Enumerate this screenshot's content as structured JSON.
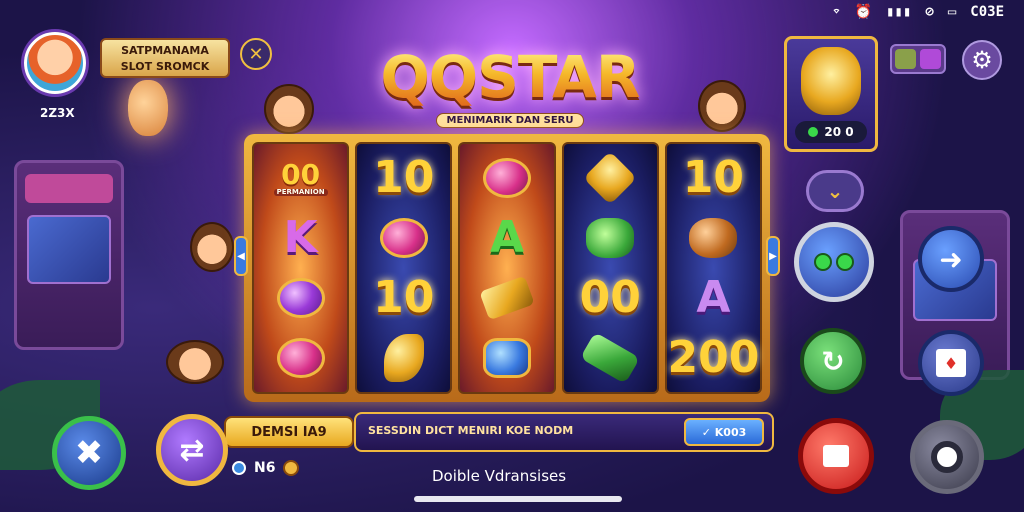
{
  "status_bar": {
    "icons": [
      "wifi-icon",
      "alarm-icon",
      "signal-icon",
      "mute-icon",
      "screen-icon"
    ],
    "battery_text": "C03E"
  },
  "player": {
    "name": "SATPMANAMA SLOT SROMCK",
    "id": "2Z3X"
  },
  "logo": {
    "title": "QQSTAR",
    "subtitle": "MENIMARIK DAN SERU"
  },
  "reels": [
    {
      "tone": "warm",
      "symbols": [
        {
          "kind": "bonus",
          "text": "00",
          "caption": "PERMANION"
        },
        {
          "kind": "letter-k",
          "text": "K"
        },
        {
          "kind": "gem",
          "style": "purple"
        },
        {
          "kind": "gem",
          "style": "pink"
        }
      ]
    },
    {
      "tone": "cool",
      "symbols": [
        {
          "kind": "num",
          "text": "10"
        },
        {
          "kind": "gem",
          "style": "pink"
        },
        {
          "kind": "num",
          "text": "10"
        },
        {
          "kind": "gem",
          "style": "gold-crescent"
        }
      ]
    },
    {
      "tone": "warm",
      "symbols": [
        {
          "kind": "gem",
          "style": "pink"
        },
        {
          "kind": "letter-a",
          "text": "A"
        },
        {
          "kind": "gem",
          "style": "gold-bar"
        },
        {
          "kind": "gem",
          "style": "blue"
        }
      ]
    },
    {
      "tone": "cool",
      "symbols": [
        {
          "kind": "gem",
          "style": "gold"
        },
        {
          "kind": "gem",
          "style": "green"
        },
        {
          "kind": "num",
          "text": "00"
        },
        {
          "kind": "gem",
          "style": "green-bar"
        }
      ]
    },
    {
      "tone": "cool",
      "symbols": [
        {
          "kind": "num",
          "text": "10"
        },
        {
          "kind": "gem",
          "style": "bronze"
        },
        {
          "kind": "letter-a2",
          "text": "A"
        },
        {
          "kind": "num",
          "text": "200"
        }
      ]
    }
  ],
  "prize": {
    "amount": "20 0"
  },
  "bottom": {
    "bet_label": "DEMSI IA9",
    "bet_amount": "N6",
    "message": "SESSDIN DICT MENIRI KOE NODM",
    "message_button": "✓ K003",
    "footer_label": "Doible Vdransises"
  },
  "colors": {
    "accent_gold": "#f0b840",
    "bg_purple": "#2a1c5e"
  }
}
